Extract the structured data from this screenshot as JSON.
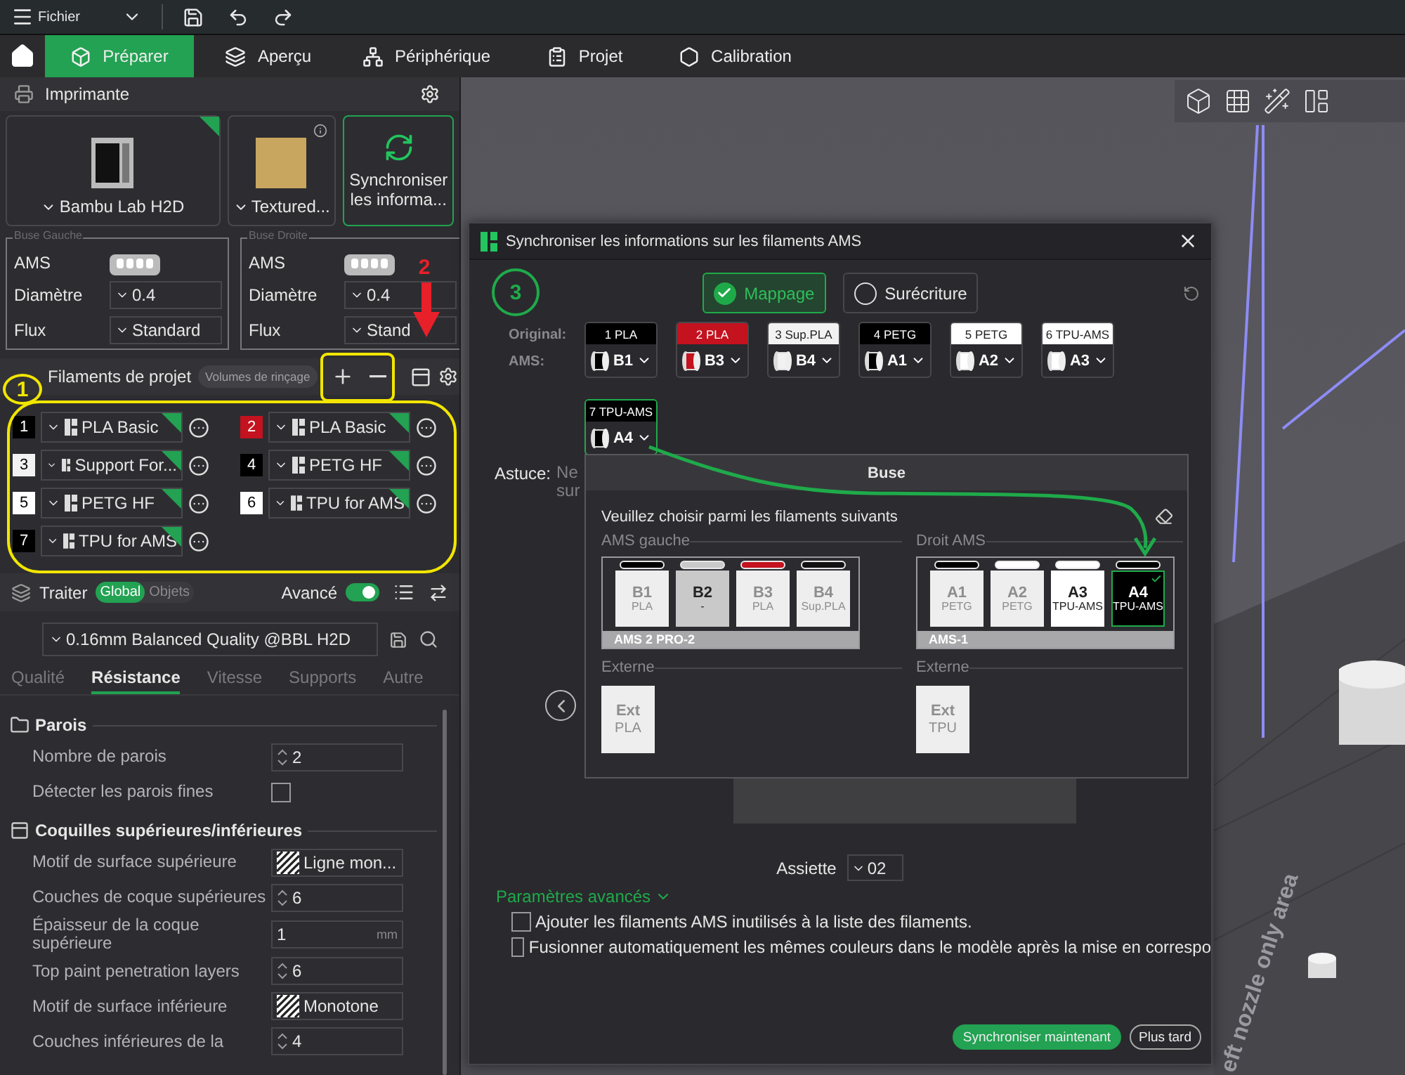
{
  "menu_bar": {
    "file_menu": "Fichier"
  },
  "nav_tabs": [
    {
      "label": "Préparer",
      "selected": true
    },
    {
      "label": "Aperçu",
      "selected": false
    },
    {
      "label": "Périphérique",
      "selected": false
    },
    {
      "label": "Projet",
      "selected": false
    },
    {
      "label": "Calibration",
      "selected": false
    }
  ],
  "printer_section": {
    "title": "Imprimante",
    "printer": "Bambu Lab H2D",
    "plate": "Textured...",
    "sync_button": "Synchroniser les informa...",
    "nozzles": [
      {
        "legend": "Buse Gauche",
        "ams_label": "AMS",
        "diameter_label": "Diamètre",
        "diameter": "0.4",
        "flow_label": "Flux",
        "flow": "Standard"
      },
      {
        "legend": "Buse Droite",
        "ams_label": "AMS",
        "diameter_label": "Diamètre",
        "diameter": "0.4",
        "flow_label": "Flux",
        "flow": "Stand"
      }
    ]
  },
  "filaments": {
    "title": "Filaments de projet",
    "flush_button": "Volumes de rinçage",
    "items": [
      {
        "number": "1",
        "color": "#000000",
        "name": "PLA Basic"
      },
      {
        "number": "2",
        "color": "#c4121f",
        "name": "PLA Basic"
      },
      {
        "number": "3",
        "color": "#f2f2f2",
        "name": "Support For..."
      },
      {
        "number": "4",
        "color": "#000000",
        "name": "PETG HF"
      },
      {
        "number": "5",
        "color": "#ffffff",
        "name": "PETG HF"
      },
      {
        "number": "6",
        "color": "#ffffff",
        "name": "TPU for AMS"
      },
      {
        "number": "7",
        "color": "#000000",
        "name": "TPU for AMS"
      }
    ]
  },
  "process": {
    "title": "Traiter",
    "scope_tabs": [
      {
        "label": "Global",
        "selected": true
      },
      {
        "label": "Objets",
        "selected": false
      }
    ],
    "advanced_label": "Avancé",
    "advanced_on": true,
    "preset": "0.16mm Balanced Quality @BBL H2D",
    "tabs": [
      {
        "label": "Qualité",
        "selected": false
      },
      {
        "label": "Résistance",
        "selected": true
      },
      {
        "label": "Vitesse",
        "selected": false
      },
      {
        "label": "Supports",
        "selected": false
      },
      {
        "label": "Autre",
        "selected": false
      }
    ],
    "groups": [
      {
        "title": "Parois",
        "settings": [
          {
            "kind": "spin",
            "label": "Nombre de parois",
            "value": "2"
          },
          {
            "kind": "checkbox",
            "label": "Détecter les parois fines",
            "checked": false
          }
        ]
      },
      {
        "title": "Coquilles supérieures/inférieures",
        "settings": [
          {
            "kind": "pattern",
            "label": "Motif de surface supérieure",
            "value": "Ligne mon..."
          },
          {
            "kind": "spin",
            "label": "Couches de coque supérieures",
            "value": "6"
          },
          {
            "kind": "unit",
            "label": "Épaisseur de la coque supérieure",
            "value": "1",
            "unit": "mm"
          },
          {
            "kind": "spin",
            "label": "Top paint penetration layers",
            "value": "6"
          },
          {
            "kind": "pattern",
            "label": "Motif de surface inférieure",
            "value": "Monotone"
          },
          {
            "kind": "spin",
            "label": "Couches inférieures de la",
            "value": "4"
          }
        ]
      }
    ]
  },
  "viewport": {
    "bed_text": "eft nozzle only area"
  },
  "dialog": {
    "title": "Synchroniser les informations sur les filaments AMS",
    "modes": [
      {
        "label": "Mappage",
        "selected": true
      },
      {
        "label": "Surécriture",
        "selected": false
      }
    ],
    "original_label": "Original:",
    "ams_label": "AMS:",
    "mappings": [
      {
        "original": "1 PLA",
        "color": "#000000",
        "slot": "B1",
        "selected": false
      },
      {
        "original": "2 PLA",
        "color": "#c4121f",
        "slot": "B3",
        "selected": false
      },
      {
        "original": "3 Sup.PLA",
        "color": "#f2f2f2",
        "slot": "B4",
        "selected": false
      },
      {
        "original": "4 PETG",
        "color": "#000000",
        "slot": "A1",
        "selected": false
      },
      {
        "original": "5 PETG",
        "color": "#ffffff",
        "slot": "A2",
        "selected": false
      },
      {
        "original": "6 TPU-AMS",
        "color": "#ffffff",
        "slot": "A3",
        "selected": false
      },
      {
        "original": "7 TPU-AMS",
        "color": "#000000",
        "slot": "A4",
        "selected": true
      }
    ],
    "tip_label": "Astuce:",
    "tip_text": "Ne sur",
    "plate_label": "Assiette",
    "plate": "02",
    "advanced": "Paramètres avancés",
    "options": [
      {
        "label": "Ajouter les filaments AMS inutilisés à la liste des filaments.",
        "checked": false
      },
      {
        "label": "Fusionner automatiquement les mêmes couleurs dans le modèle après la mise en correspo",
        "checked": false
      }
    ],
    "buttons": [
      {
        "label": "Synchroniser maintenant",
        "kind": "primary"
      },
      {
        "label": "Plus tard",
        "kind": "secondary"
      }
    ]
  },
  "nozzle_popup": {
    "title": "Buse",
    "prompt": "Veuillez choisir parmi les filaments suivants",
    "columns": [
      {
        "title": "AMS gauche",
        "unit": "AMS 2 PRO-2",
        "external_title": "Externe",
        "slots": [
          {
            "id": "B1",
            "material": "PLA",
            "color": "#000000",
            "disabled": true,
            "selected": false
          },
          {
            "id": "B2",
            "material": "-",
            "color": "#c9c9c9",
            "disabled": false,
            "selected": false
          },
          {
            "id": "B3",
            "material": "PLA",
            "color": "#c4121f",
            "disabled": true,
            "selected": false
          },
          {
            "id": "B4",
            "material": "Sup.PLA",
            "color": "#111111",
            "disabled": true,
            "selected": false
          }
        ],
        "external": {
          "id": "Ext",
          "material": "PLA"
        }
      },
      {
        "title": "Droit AMS",
        "unit": "AMS-1",
        "external_title": "Externe",
        "slots": [
          {
            "id": "A1",
            "material": "PETG",
            "color": "#000000",
            "disabled": true,
            "selected": false
          },
          {
            "id": "A2",
            "material": "PETG",
            "color": "#ffffff",
            "disabled": true,
            "selected": false
          },
          {
            "id": "A3",
            "material": "TPU-AMS",
            "color": "#ffffff",
            "disabled": false,
            "selected": false
          },
          {
            "id": "A4",
            "material": "TPU-AMS",
            "color": "#000000",
            "disabled": false,
            "selected": true
          }
        ],
        "external": {
          "id": "Ext",
          "material": "TPU"
        }
      }
    ]
  },
  "annotations": [
    {
      "label": "1",
      "color": "#f2e600",
      "kind": "circle"
    },
    {
      "label": "2",
      "color": "#e8202a",
      "kind": "plain"
    },
    {
      "label": "3",
      "color": "#1faa4a",
      "kind": "circle"
    }
  ]
}
